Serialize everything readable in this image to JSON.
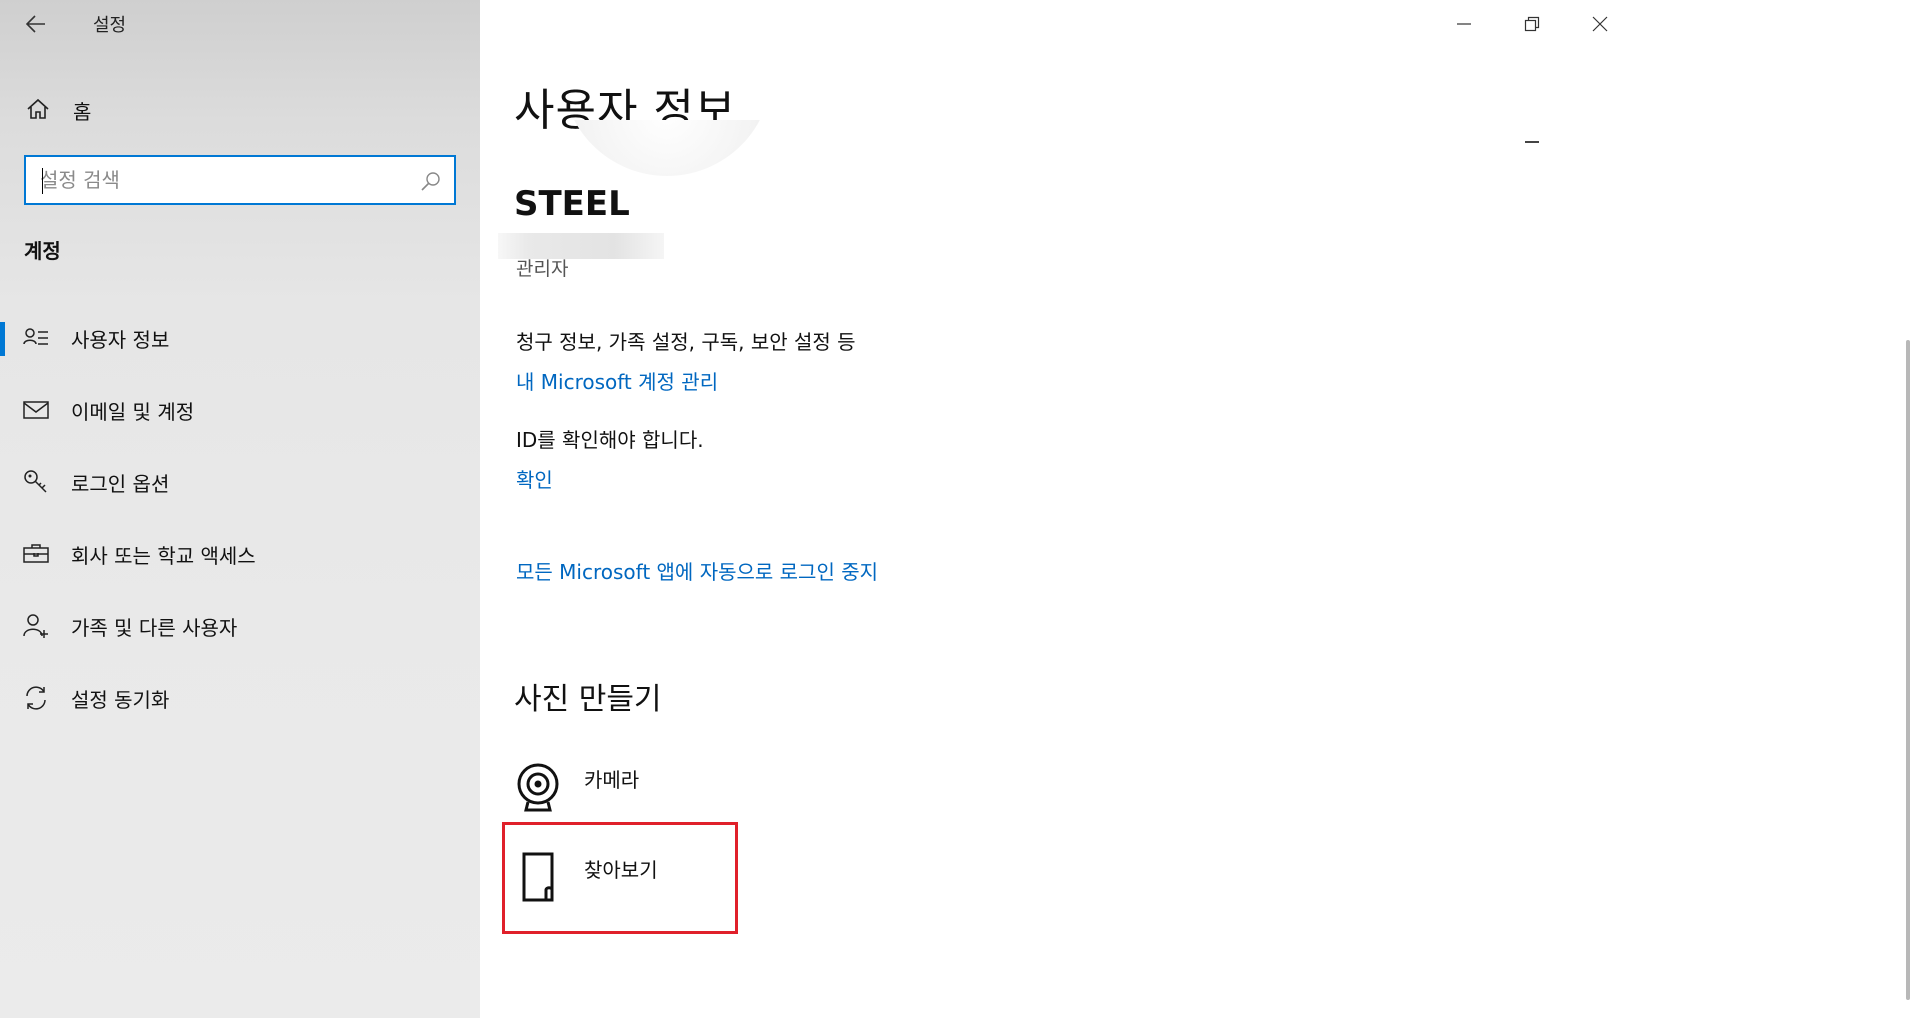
{
  "window": {
    "title": "설정"
  },
  "sidebar": {
    "home_label": "홈",
    "search_placeholder": "설정 검색",
    "section_title": "계정",
    "items": [
      {
        "label": "사용자 정보",
        "icon": "user-info-icon",
        "active": true
      },
      {
        "label": "이메일 및 계정",
        "icon": "mail-icon",
        "active": false
      },
      {
        "label": "로그인 옵션",
        "icon": "key-icon",
        "active": false
      },
      {
        "label": "회사 또는 학교 액세스",
        "icon": "briefcase-icon",
        "active": false
      },
      {
        "label": "가족 및 다른 사용자",
        "icon": "add-user-icon",
        "active": false
      },
      {
        "label": "설정 동기화",
        "icon": "sync-icon",
        "active": false
      }
    ]
  },
  "main": {
    "page_title": "사용자 정보",
    "username": "STEEL",
    "role": "관리자",
    "billing_text": "청구 정보, 가족 설정, 구독, 보안 설정 등",
    "manage_account_link": "내 Microsoft 계정 관리",
    "verify_text": "ID를 확인해야 합니다.",
    "verify_link": "확인",
    "stop_signin_link": "모든 Microsoft 앱에 자동으로 로그인 중지",
    "create_photo_title": "사진 만들기",
    "options": [
      {
        "label": "카메라",
        "icon": "camera-icon"
      },
      {
        "label": "찾아보기",
        "icon": "browse-file-icon"
      }
    ]
  },
  "colors": {
    "accent": "#0078d4",
    "link": "#0067c0",
    "highlight_box": "#e0202a"
  }
}
